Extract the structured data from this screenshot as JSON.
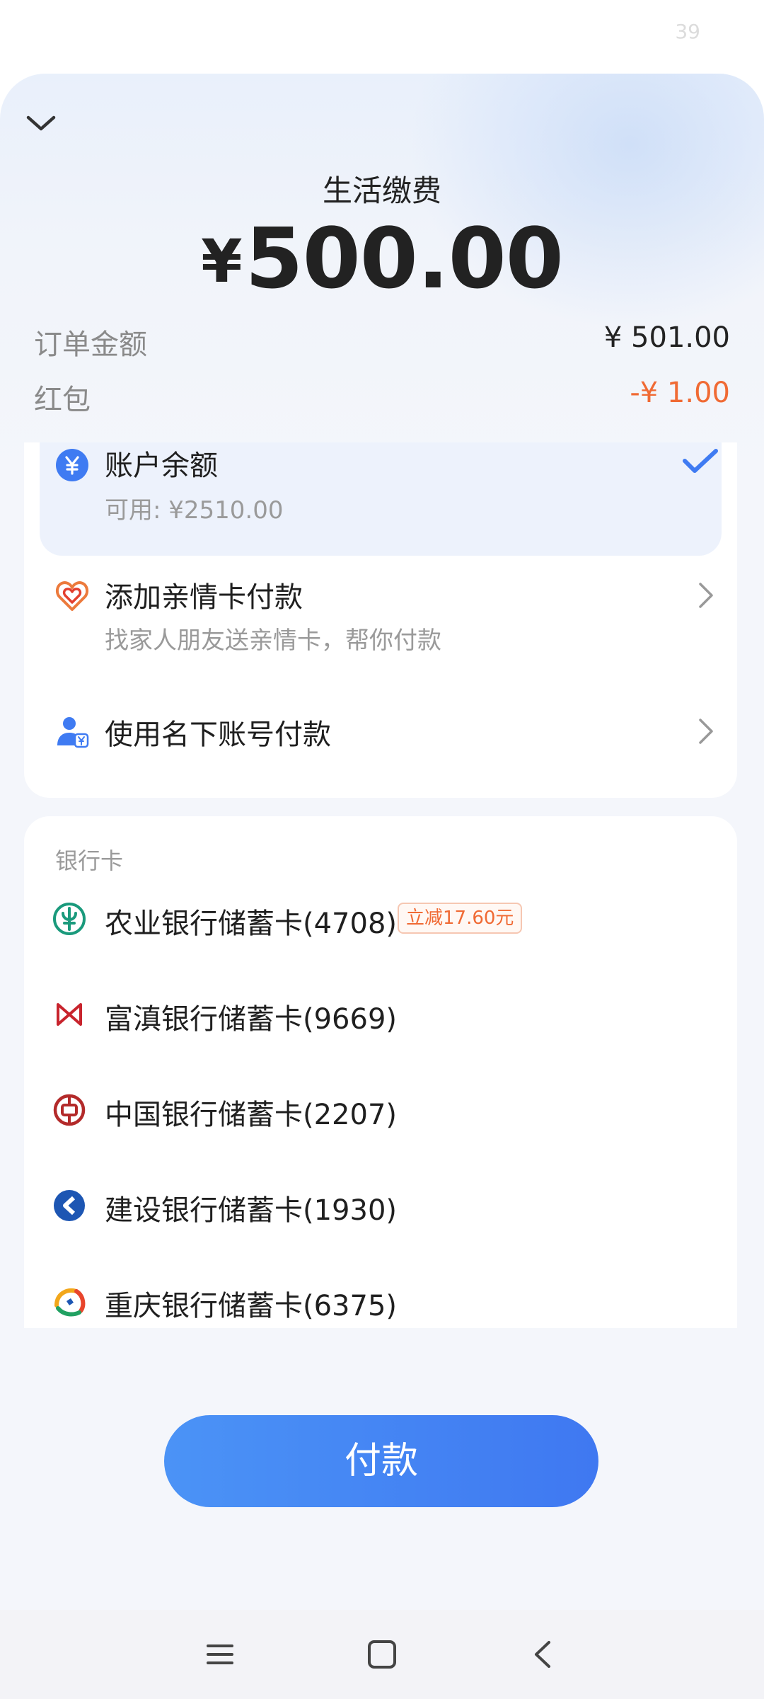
{
  "status_bar": {
    "time": "39"
  },
  "header": {
    "title": "生活缴费",
    "currency_symbol": "¥",
    "amount": "500.00"
  },
  "summary": {
    "order_label": "订单金额",
    "order_value": "¥ 501.00",
    "coupon_label": "红包",
    "coupon_value": "-¥ 1.00"
  },
  "payment_options": {
    "balance": {
      "title": "账户余额",
      "subtitle": "可用: ¥2510.00",
      "selected": true
    },
    "family_card": {
      "title": "添加亲情卡付款",
      "subtitle": "找家人朋友送亲情卡，帮你付款"
    },
    "own_account": {
      "title": "使用名下账号付款"
    }
  },
  "bank_cards": {
    "section_label": "银行卡",
    "items": [
      {
        "name": "农业银行储蓄卡(4708)",
        "badge": "立减17.60元",
        "icon": "abc-bank-icon",
        "color": "#1a9a7c"
      },
      {
        "name": "富滇银行储蓄卡(9669)",
        "icon": "fudian-bank-icon",
        "color": "#c8242d"
      },
      {
        "name": "中国银行储蓄卡(2207)",
        "icon": "boc-bank-icon",
        "color": "#b32a2a"
      },
      {
        "name": "建设银行储蓄卡(1930)",
        "icon": "ccb-bank-icon",
        "color": "#1d56b3"
      },
      {
        "name": "重庆银行储蓄卡(6375)",
        "icon": "cq-bank-icon",
        "color": "#e8452c"
      }
    ]
  },
  "pay_button": {
    "label": "付款"
  },
  "colors": {
    "accent": "#3f7bf2",
    "discount": "#f06a34"
  },
  "nav": {
    "icons": [
      "menu-icon",
      "home-square-icon",
      "back-icon"
    ]
  }
}
